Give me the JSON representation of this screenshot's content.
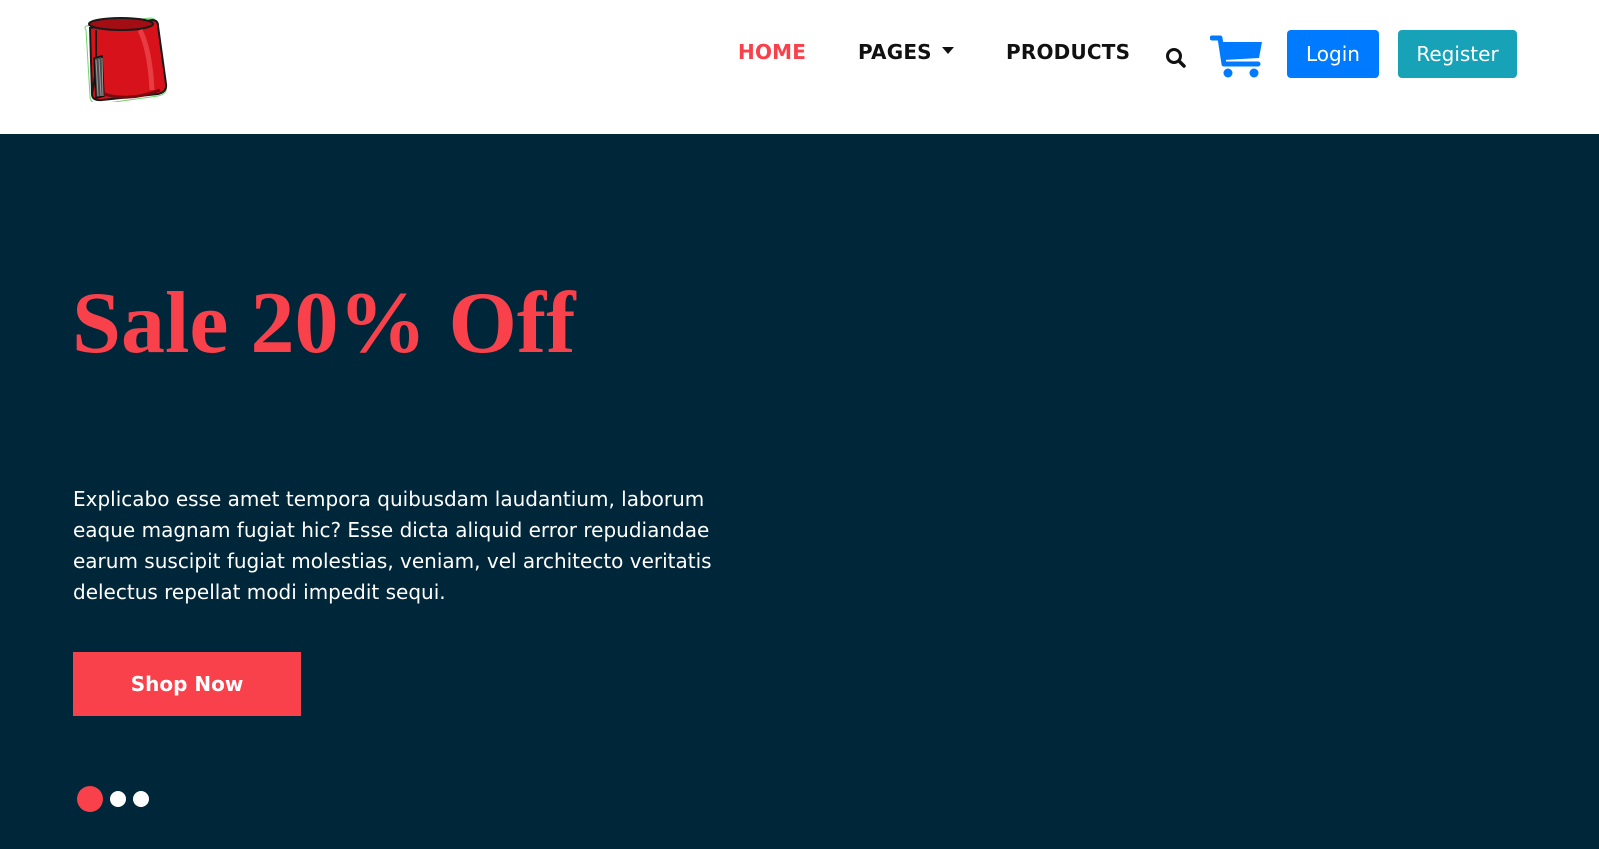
{
  "header": {
    "logo_icon": "red-fez-hat-icon",
    "nav": {
      "home": "HOME",
      "pages": "PAGES",
      "products": "PRODUCTS"
    },
    "search_icon": "search-icon",
    "cart_icon": "shopping-cart-icon",
    "login_label": "Login",
    "register_label": "Register"
  },
  "hero": {
    "title": "Sale 20% Off",
    "text": "Explicabo esse amet tempora quibusdam laudantium, laborum eaque magnam fugiat hic? Esse dicta aliquid error repudiandae earum suscipit fugiat molestias, veniam, vel architecto veritatis delectus repellat modi impedit sequi.",
    "button_label": "Shop Now",
    "slides_total": 3,
    "active_slide": 1
  },
  "colors": {
    "accent": "#f8414b",
    "hero_background": "#00263a",
    "login_button": "#007bff",
    "register_button": "#17a2b8",
    "cart_icon": "#007bff"
  }
}
